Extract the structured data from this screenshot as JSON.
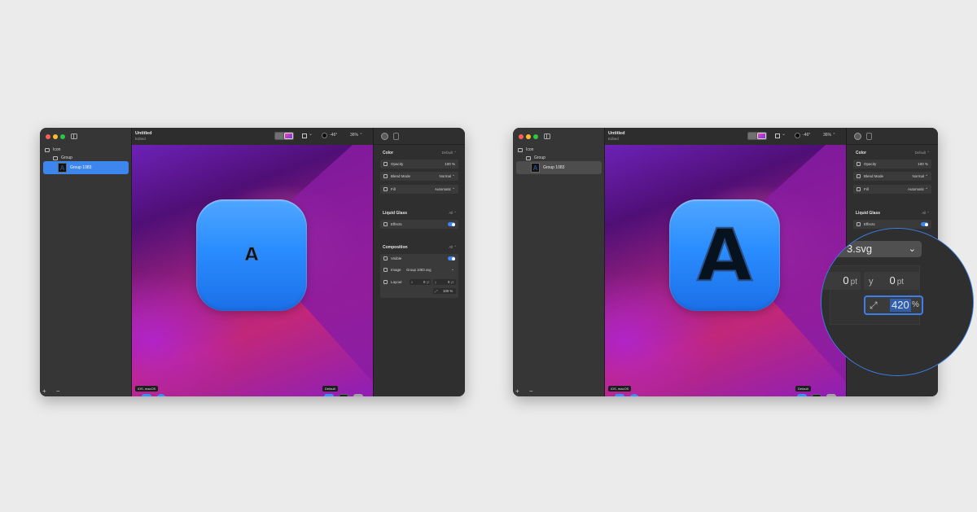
{
  "panels": [
    {
      "sidebar": {
        "tree": [
          {
            "label": "Icon",
            "icon": "icon-doc-icon"
          },
          {
            "label": "Group",
            "icon": "folder-icon"
          },
          {
            "label": "Group 1083",
            "icon": "layer-thumbnail",
            "selected": true
          }
        ],
        "footer": "+  −"
      },
      "toolbar": {
        "title": "Untitled",
        "subtitle": "Edited",
        "light_angle": "-46°",
        "zoom": "36% ⌃"
      },
      "canvas": {
        "glyph": "A",
        "platform_badge": "iOS, macOS",
        "appearance_badge": "Default"
      },
      "inspector": {
        "color": {
          "title": "Color",
          "option": "Default ⌃",
          "opacity_label": "Opacity",
          "opacity_value": "100 %",
          "blend_label": "Blend Mode",
          "blend_value": "Normal ⌃",
          "fill_label": "Fill",
          "fill_value": "Automatic ⌃"
        },
        "liquid_glass": {
          "title": "Liquid Glass",
          "option": "All ⌃",
          "effects_label": "Effects"
        },
        "composition": {
          "title": "Composition",
          "option": "All ⌃",
          "visible_label": "Visible",
          "image_label": "Image",
          "image_value": "Group 1083.svg",
          "layout_label": "Layout",
          "x_value": "0",
          "y_value": "0",
          "scale_value": "100 %"
        }
      }
    },
    {
      "sidebar": {
        "tree": [
          {
            "label": "Icon",
            "icon": "icon-doc-icon"
          },
          {
            "label": "Group",
            "icon": "folder-icon"
          },
          {
            "label": "Group 1083",
            "icon": "layer-thumbnail",
            "selected": true
          }
        ],
        "footer": "+  −"
      },
      "toolbar": {
        "title": "Untitled",
        "subtitle": "Edited",
        "light_angle": "-46°",
        "zoom": "36% ⌃"
      },
      "canvas": {
        "glyph": "A",
        "platform_badge": "iOS, macOS",
        "appearance_badge": "Default"
      },
      "inspector": {
        "color": {
          "title": "Color",
          "option": "Default ⌃",
          "opacity_label": "Opacity",
          "opacity_value": "100 %",
          "blend_label": "Blend Mode",
          "blend_value": "Normal ⌃",
          "fill_label": "Fill",
          "fill_value": "Automatic ⌃"
        },
        "liquid_glass": {
          "title": "Liquid Glass",
          "option": "All ⌃",
          "effects_label": "Effects"
        }
      }
    }
  ],
  "zoom_callout": {
    "image_value": "3.svg",
    "x_value": "0",
    "y_label": "y",
    "y_value": "0",
    "unit_pt": "pt",
    "scale_value": "420",
    "unit_pct": "%"
  },
  "colors": {
    "accent": "#3d86ee",
    "icon_blue": "#2a8dff",
    "callout_ring": "#3b80e6"
  }
}
